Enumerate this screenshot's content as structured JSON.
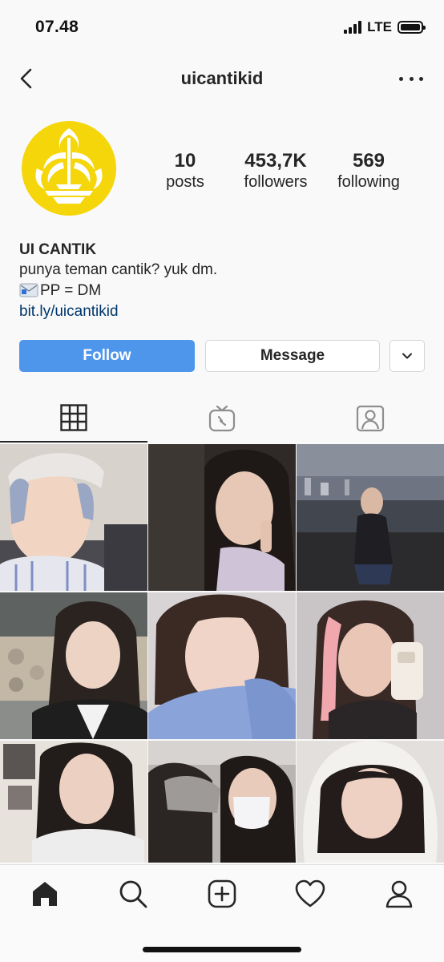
{
  "status_bar": {
    "time": "07.48",
    "network": "LTE"
  },
  "header": {
    "username": "uicantikid",
    "back_icon": "chevron-left-icon",
    "more_icon": "more-horizontal-icon"
  },
  "profile": {
    "avatar_icon": "ui-logo-avatar",
    "stats": [
      {
        "value": "10",
        "label": "posts"
      },
      {
        "value": "453,7K",
        "label": "followers"
      },
      {
        "value": "569",
        "label": "following"
      }
    ],
    "name": "UI CANTIK",
    "bio_line1": "punya teman cantik? yuk dm.",
    "bio_line2": "PP = DM",
    "link": "bit.ly/uicantikid"
  },
  "actions": {
    "follow_label": "Follow",
    "message_label": "Message",
    "dropdown_icon": "chevron-down-icon"
  },
  "tabs": [
    {
      "name": "posts-grid",
      "icon": "grid-icon",
      "active": true
    },
    {
      "name": "igtv",
      "icon": "igtv-icon",
      "active": false
    },
    {
      "name": "tagged",
      "icon": "tagged-person-icon",
      "active": false
    }
  ],
  "grid_posts": [
    "photo-1",
    "photo-2",
    "photo-3",
    "photo-4",
    "photo-5",
    "photo-6",
    "photo-7",
    "photo-8",
    "photo-9"
  ],
  "bottom_nav": [
    {
      "icon": "home-icon",
      "active": true
    },
    {
      "icon": "search-icon",
      "active": false
    },
    {
      "icon": "add-post-icon",
      "active": false
    },
    {
      "icon": "heart-icon",
      "active": false
    },
    {
      "icon": "profile-icon",
      "active": false
    }
  ],
  "colors": {
    "follow_button": "#4d96ec",
    "link": "#00376b",
    "avatar_logo": "#f5d60b"
  }
}
